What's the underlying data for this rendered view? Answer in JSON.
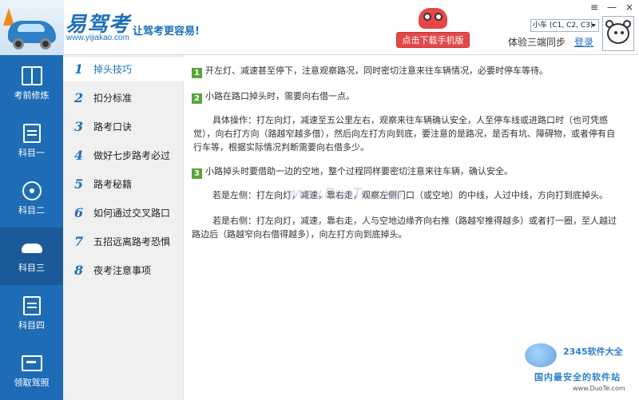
{
  "header": {
    "brand": "易驾考",
    "brand_url": "www.yijiakao.com",
    "slogan": "让驾考更容易!",
    "download_btn": "点击下载手机版",
    "car_select": "小车 (C1, C2, C3)",
    "sync_label": "体验三端同步",
    "login": "登录",
    "win_controls": {
      "menu": "≡",
      "minimize": "—",
      "close": "×"
    }
  },
  "leftnav": {
    "items": [
      {
        "label": "考前修炼",
        "icon": "book-icon"
      },
      {
        "label": "科目一",
        "icon": "note-icon"
      },
      {
        "label": "科目二",
        "icon": "steering-wheel-icon"
      },
      {
        "label": "科目三",
        "icon": "car-icon",
        "active": true
      },
      {
        "label": "科目四",
        "icon": "note-icon"
      },
      {
        "label": "领取驾照",
        "icon": "license-card-icon"
      }
    ]
  },
  "subnav": {
    "items": [
      {
        "num": "1",
        "label": "掉头技巧",
        "active": true
      },
      {
        "num": "2",
        "label": "扣分标准"
      },
      {
        "num": "3",
        "label": "路考口诀"
      },
      {
        "num": "4",
        "label": "做好七步路考必过"
      },
      {
        "num": "5",
        "label": "路考秘籍"
      },
      {
        "num": "6",
        "label": "如何通过交叉路口"
      },
      {
        "num": "7",
        "label": "五招远离路考恐惧"
      },
      {
        "num": "8",
        "label": "夜考注意事项"
      }
    ]
  },
  "content": {
    "p1_num": "1",
    "p1": "开左灯、减速甚至停下，注意观察路况，同时密切注意来往车辆情况，必要时停车等待。",
    "p2_num": "2",
    "p2": "小路在路口掉头时，需要向右借一点。",
    "p3": "具体操作：打左向灯，减速至五公里左右，观察来往车辆确认安全，人至停车线或进路口时（也可凭感觉），向右打方向（路越窄越多借），然后向左打方向到底，要注意的是路况，是否有坑、障碍物，或者停有自行车等，根据实际情况判断需要向右借多少。",
    "p4_num": "3",
    "p4": "小路掉头时要借助一边的空地，整个过程同样要密切注意来往车辆，确认安全。",
    "p5": "若是左侧：打左向灯，减速，靠右走，观察左侧门口（或空地）的中线，人过中线，方向打到底掉头。",
    "p6": "若是右侧：打左向灯，减速，靠右走，人与空地边缘齐向右推（路越窄推得越多）或者打一圈，至人越过路边后（路越窄向右借得越多），向左打方向到底掉头。"
  },
  "watermarks": {
    "center": "www.DuoTe.com",
    "br_top": "2345软件大全",
    "br_mid": "国内最安全的软件站",
    "br_url": "www.DuoTe.com"
  }
}
